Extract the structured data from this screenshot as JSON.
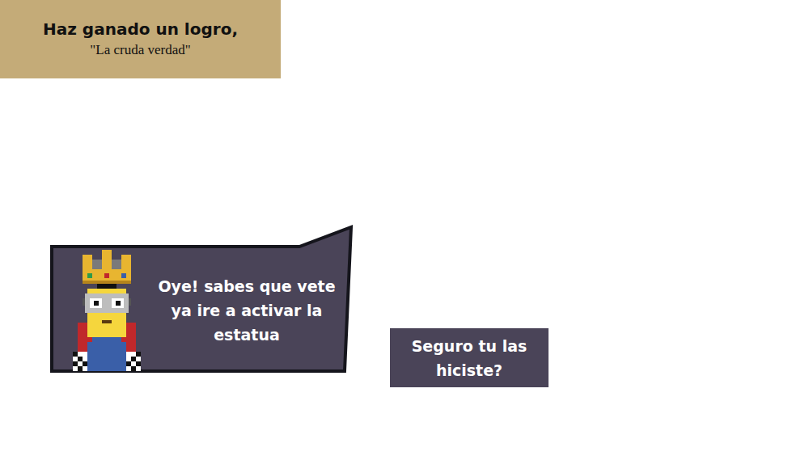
{
  "achievement": {
    "title": "Haz ganado un logro,",
    "name": "\"La cruda verdad\""
  },
  "dialogue": {
    "text": "Oye! sabes que vete ya ire a activar la estatua"
  },
  "choices": [
    {
      "label": "Seguro tu las hiciste?"
    }
  ]
}
